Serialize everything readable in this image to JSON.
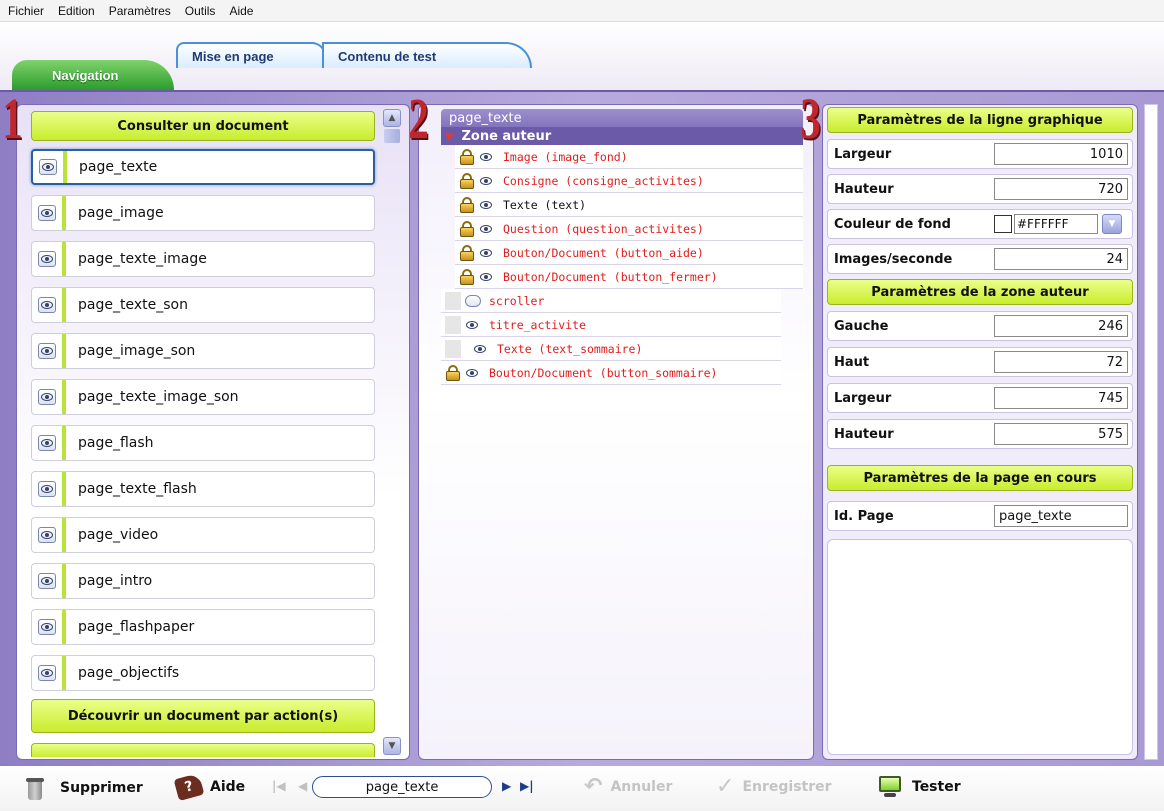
{
  "menu": [
    "Fichier",
    "Edition",
    "Paramètres",
    "Outils",
    "Aide"
  ],
  "tabs": {
    "navigation": "Navigation",
    "mise_en_page": "Mise en page",
    "contenu_de_test": "Contenu de test"
  },
  "markers": [
    "1",
    "2",
    "3"
  ],
  "panel1": {
    "header_top": "Consulter un document",
    "items": [
      "page_texte",
      "page_image",
      "page_texte_image",
      "page_texte_son",
      "page_image_son",
      "page_texte_image_son",
      "page_flash",
      "page_texte_flash",
      "page_video",
      "page_intro",
      "page_flashpaper",
      "page_objectifs"
    ],
    "selected_item": "page_texte",
    "header_bottom": "Découvrir un document par action(s)"
  },
  "panel2": {
    "title": "page_texte",
    "zone": "Zone auteur",
    "rows": [
      {
        "label": "Image (image_fond)",
        "locked": true,
        "color": "red"
      },
      {
        "label": "Consigne (consigne_activites)",
        "locked": true,
        "color": "red"
      },
      {
        "label": "Texte (text)",
        "locked": true,
        "color": "black"
      },
      {
        "label": "Question (question_activites)",
        "locked": true,
        "color": "red"
      },
      {
        "label": "Bouton/Document (button_aide)",
        "locked": true,
        "color": "red"
      },
      {
        "label": "Bouton/Document (button_fermer)",
        "locked": true,
        "color": "red"
      },
      {
        "label": "scroller",
        "locked": false,
        "color": "red",
        "icon": "scroller"
      },
      {
        "label": "titre_activite",
        "locked": false,
        "color": "red"
      },
      {
        "label": "Texte (text_sommaire)",
        "locked": false,
        "color": "red"
      },
      {
        "label": "Bouton/Document (button_sommaire)",
        "locked": true,
        "color": "red"
      }
    ]
  },
  "panel3": {
    "header_ligne": "Paramètres de la ligne graphique",
    "largeur_label": "Largeur",
    "largeur_value": "1010",
    "hauteur_label": "Hauteur",
    "hauteur_value": "720",
    "couleur_label": "Couleur de fond",
    "couleur_value": "#FFFFFF",
    "images_label": "Images/seconde",
    "images_value": "24",
    "header_zone": "Paramètres de la zone auteur",
    "gauche_label": "Gauche",
    "gauche_value": "246",
    "haut_label": "Haut",
    "haut_value": "72",
    "zlargeur_label": "Largeur",
    "zlargeur_value": "745",
    "zhauteur_label": "Hauteur",
    "zhauteur_value": "575",
    "header_page": "Paramètres de la page en cours",
    "idpage_label": "Id. Page",
    "idpage_value": "page_texte"
  },
  "toolbar": {
    "supprimer": "Supprimer",
    "aide": "Aide",
    "current_page": "page_texte",
    "annuler": "Annuler",
    "enregistrer": "Enregistrer",
    "tester": "Tester"
  }
}
